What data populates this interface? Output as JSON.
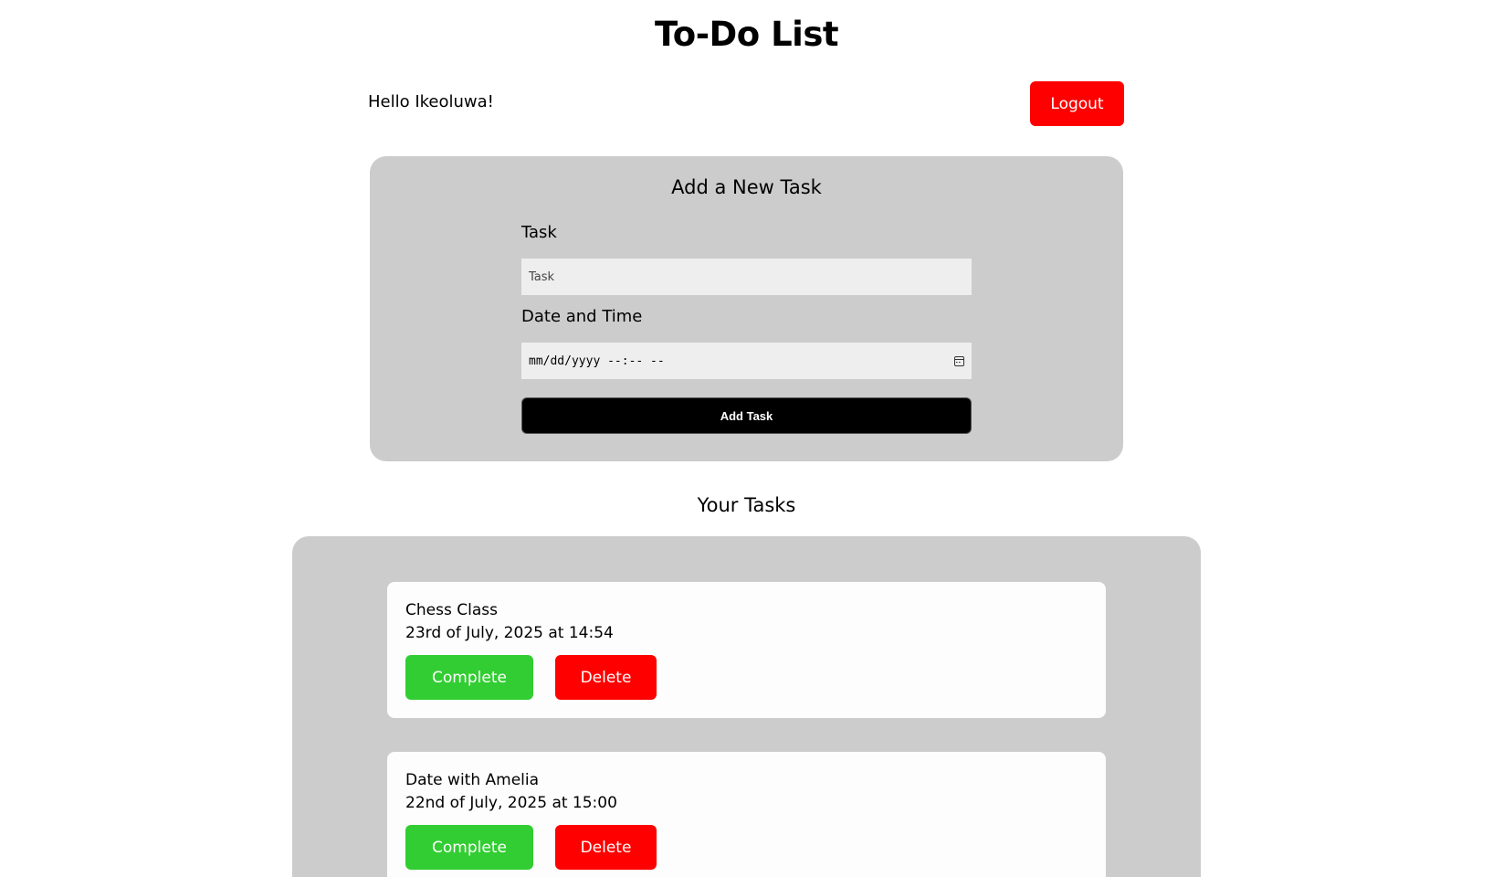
{
  "header": {
    "title": "To-Do List",
    "greeting": "Hello Ikeoluwa!",
    "logout_label": "Logout"
  },
  "add_form": {
    "title": "Add a New Task",
    "task_label": "Task",
    "task_placeholder": "Task",
    "task_value": "",
    "date_label": "Date and Time",
    "date_placeholder": "mm/dd/yyyy --:-- --",
    "submit_label": "Add Task"
  },
  "tasks_section": {
    "heading": "Your Tasks",
    "tasks": [
      {
        "name": "Chess Class",
        "date": "23rd of July, 2025 at 14:54",
        "complete_label": "Complete",
        "delete_label": "Delete"
      },
      {
        "name": "Date with Amelia",
        "date": "22nd of July, 2025 at 15:00",
        "complete_label": "Complete",
        "delete_label": "Delete"
      }
    ]
  },
  "colors": {
    "logout": "#ff0000",
    "panel_bg": "#cccccc",
    "complete": "#32cd32",
    "delete": "#ff0000",
    "add_button": "#000000"
  }
}
